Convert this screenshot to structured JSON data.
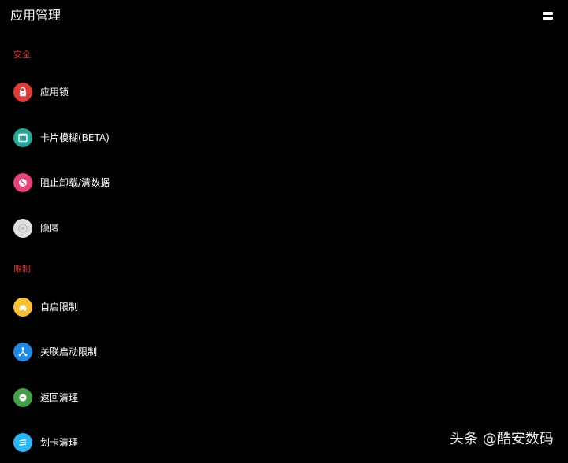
{
  "header": {
    "title": "应用管理",
    "menu_icon": "menu-icon"
  },
  "sections": [
    {
      "label": "安全",
      "color": "#e53935",
      "items": [
        {
          "label": "应用锁",
          "icon": "lock-icon",
          "color": "#e53935"
        },
        {
          "label": "卡片模糊(BETA)",
          "icon": "window-icon",
          "color": "#26a69a"
        },
        {
          "label": "阻止卸载/清数据",
          "icon": "block-icon",
          "color": "#ec407a"
        },
        {
          "label": "隐匿",
          "icon": "hidden-icon",
          "color": "#e0e0e0"
        }
      ]
    },
    {
      "label": "限制",
      "color": "#e53935",
      "items": [
        {
          "label": "自启限制",
          "icon": "car-icon",
          "color": "#fbc02d"
        },
        {
          "label": "关联启动限制",
          "icon": "network-icon",
          "color": "#1e88e5"
        },
        {
          "label": "返回清理",
          "icon": "back-clean-icon",
          "color": "#43a047"
        },
        {
          "label": "划卡清理",
          "icon": "swipe-clean-icon",
          "color": "#29b6f6"
        }
      ]
    }
  ],
  "watermark": "头条 @酷安数码"
}
